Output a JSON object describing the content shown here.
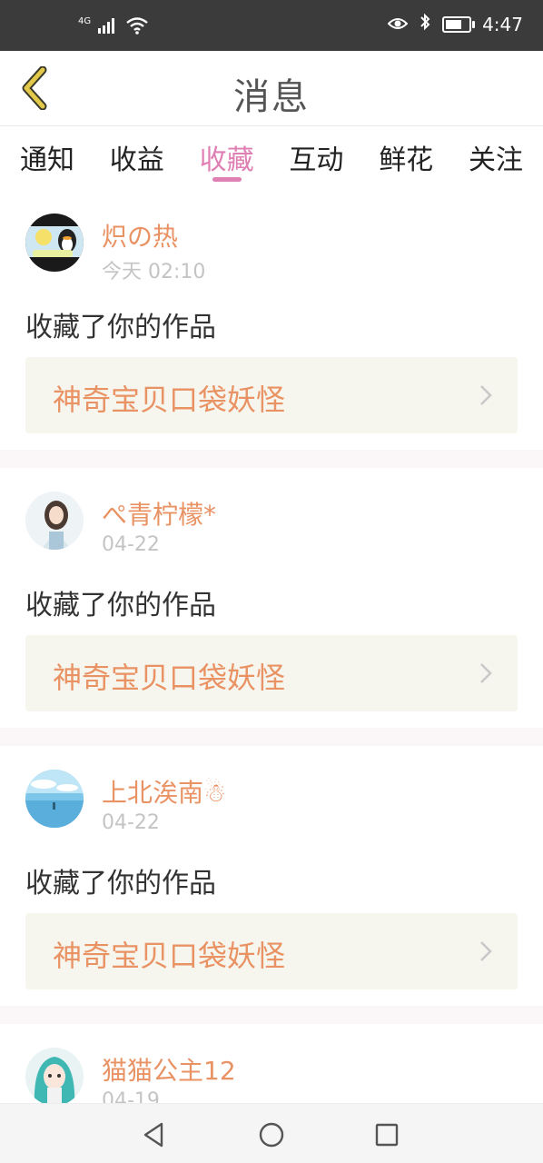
{
  "status_bar": {
    "network": "4G",
    "time": "4:47",
    "icons": [
      "signal-icon",
      "wifi-icon",
      "eye-icon",
      "bluetooth-icon",
      "battery-icon"
    ]
  },
  "header": {
    "title": "消息",
    "back_icon": "chevron-left-icon"
  },
  "tabs": [
    {
      "label": "通知",
      "active": false
    },
    {
      "label": "收益",
      "active": false
    },
    {
      "label": "收藏",
      "active": true
    },
    {
      "label": "互动",
      "active": false
    },
    {
      "label": "鲜花",
      "active": false
    },
    {
      "label": "关注",
      "active": false
    }
  ],
  "items": [
    {
      "username": "炽の热",
      "time": "今天 02:10",
      "action": "收藏了你的作品",
      "work_title": "神奇宝贝口袋妖怪"
    },
    {
      "username": "ぺ青柠檬*",
      "time": "04-22",
      "action": "收藏了你的作品",
      "work_title": "神奇宝贝口袋妖怪"
    },
    {
      "username": "上北涘南☃",
      "time": "04-22",
      "action": "收藏了你的作品",
      "work_title": "神奇宝贝口袋妖怪"
    },
    {
      "username": "猫猫公主12",
      "time": "04-19"
    }
  ],
  "colors": {
    "accent_pink": "#e07fb3",
    "username_orange": "#e99263",
    "work_card_bg": "#f6f5ee",
    "back_icon_yellow": "#e3c94a"
  },
  "nav_bar": {
    "icons": [
      "back-triangle-icon",
      "home-circle-icon",
      "recents-square-icon"
    ]
  }
}
